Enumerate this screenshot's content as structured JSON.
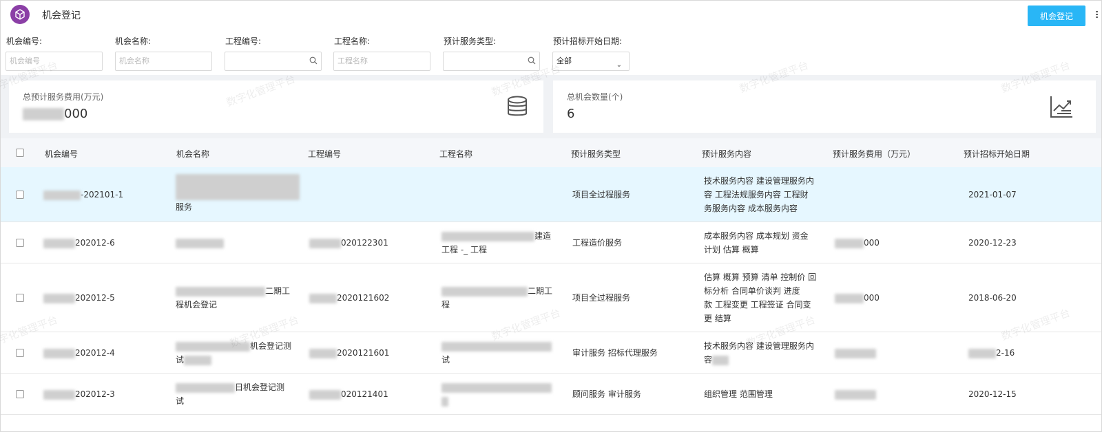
{
  "header": {
    "title": "机会登记",
    "action_label": "机会登记"
  },
  "filters": {
    "code": {
      "label": "机会编号:",
      "placeholder": "机会编号"
    },
    "name": {
      "label": "机会名称:",
      "placeholder": "机会名称"
    },
    "project_code": {
      "label": "工程编号:",
      "placeholder": ""
    },
    "project_name": {
      "label": "工程名称:",
      "placeholder": "工程名称"
    },
    "service_type": {
      "label": "预计服务类型:",
      "placeholder": ""
    },
    "bid_date": {
      "label": "预计招标开始日期:",
      "value": "全部"
    }
  },
  "cards": {
    "total_fee": {
      "label": "总预计服务费用(万元)",
      "value": "000"
    },
    "total_count": {
      "label": "总机会数量(个)",
      "value": "6"
    }
  },
  "table": {
    "columns": [
      "机会编号",
      "机会名称",
      "工程编号",
      "工程名称",
      "预计服务类型",
      "预计服务内容",
      "预计服务费用（万元）",
      "预计招标开始日期"
    ],
    "rows": [
      {
        "code": "-202101-1",
        "name": "服务",
        "project_code": "",
        "project_name": "",
        "type": "项目全过程服务",
        "content": [
          "技术服务内容 建设管理服务内",
          "容 工程法规服务内容 工程财",
          "务服务内容 成本服务内容"
        ],
        "fee": "",
        "date": "2021-01-07"
      },
      {
        "code": "202012-6",
        "name": "",
        "project_code": "020122301",
        "project_name": [
          "建造",
          "工程 -_ 工程"
        ],
        "type": "工程造价服务",
        "content": [
          "成本服务内容 成本规划 资金",
          "计划 估算 概算"
        ],
        "fee": "000",
        "date": "2020-12-23"
      },
      {
        "code": "202012-5",
        "name": [
          "二期工",
          "程机会登记"
        ],
        "project_code": "2020121602",
        "project_name": [
          "二期工",
          "程"
        ],
        "type": "项目全过程服务",
        "content": [
          "估算 概算 预算 清单 控制价 回",
          "标分析 合同单价谈判 进度",
          "款 工程变更 工程签证 合同变",
          "更 结算"
        ],
        "fee": "000",
        "date": "2018-06-20"
      },
      {
        "code": "202012-4",
        "name": [
          "机会登记测",
          "试"
        ],
        "project_code": "2020121601",
        "project_name": [
          "",
          "试"
        ],
        "type": "审计服务 招标代理服务",
        "content": [
          "技术服务内容 建设管理服务内",
          "容"
        ],
        "fee": "",
        "date": "2-16"
      },
      {
        "code": "202012-3",
        "name": [
          "日机会登记测",
          "试"
        ],
        "project_code": "020121401",
        "project_name": [
          "",
          ""
        ],
        "type": "顾问服务 审计服务",
        "content": [
          "组织管理 范围管理"
        ],
        "fee": "",
        "date": "2020-12-15"
      }
    ]
  },
  "watermark": "数字化管理平台",
  "colors": {
    "primary": "#29b6f6",
    "logo": "#8b3fa6",
    "selected_row": "#e6f7ff"
  }
}
